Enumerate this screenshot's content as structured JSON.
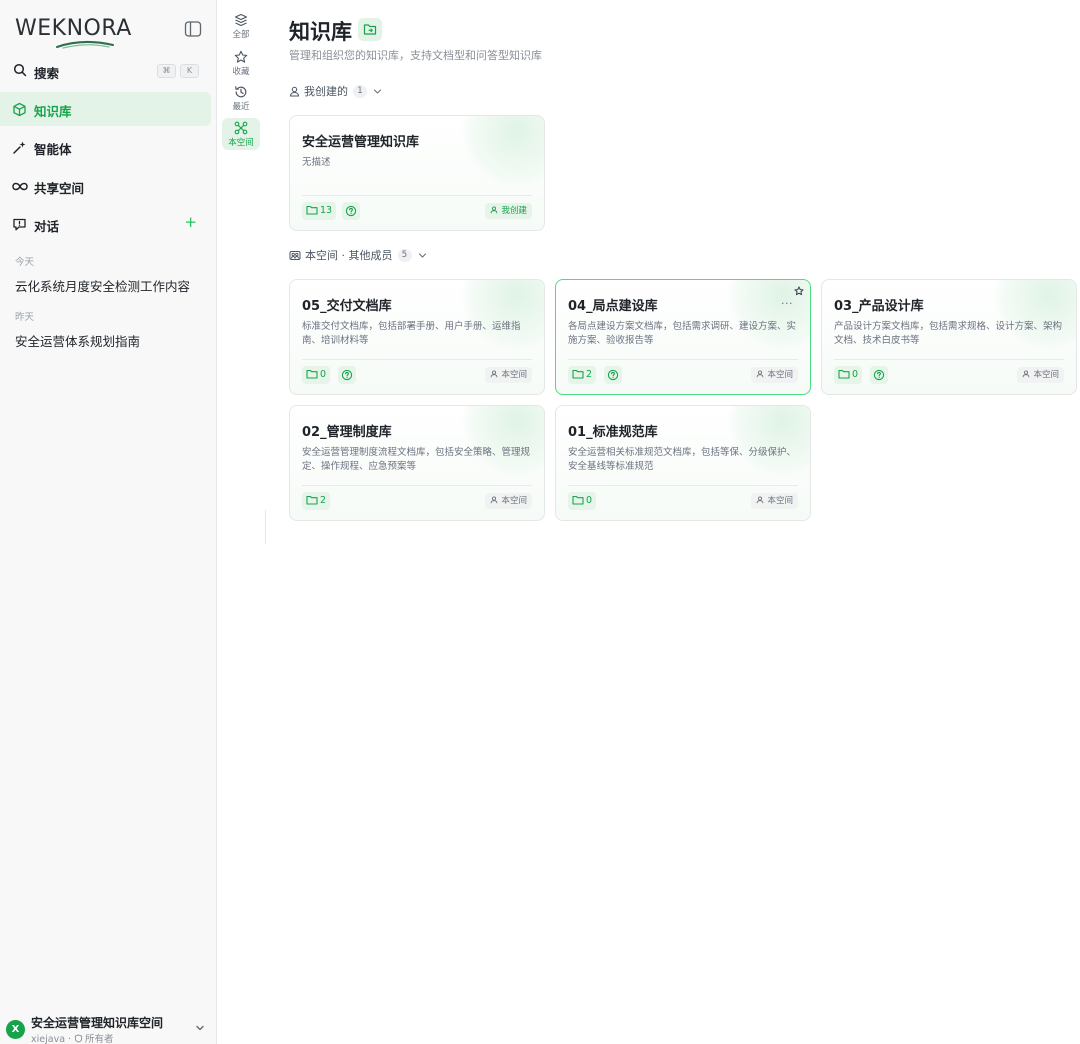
{
  "app": {
    "logo_text": "WEKNORA"
  },
  "sidebar": {
    "search": {
      "label": "搜索",
      "kbd": [
        "⌘",
        "K"
      ]
    },
    "nav": [
      {
        "key": "kb",
        "label": "知识库",
        "active": true
      },
      {
        "key": "agent",
        "label": "智能体",
        "active": false
      },
      {
        "key": "shared",
        "label": "共享空间",
        "active": false
      },
      {
        "key": "chat",
        "label": "对话",
        "active": false
      }
    ],
    "chat_groups": [
      {
        "label": "今天",
        "items": [
          "云化系统月度安全检测工作内容"
        ]
      },
      {
        "label": "昨天",
        "items": [
          "安全运营体系规划指南"
        ]
      }
    ],
    "space": {
      "avatar_letter": "X",
      "name": "安全运营管理知识库空间",
      "user": "xiejava",
      "role": "所有者"
    }
  },
  "filter_rail": [
    {
      "key": "all",
      "label": "全部",
      "active": false
    },
    {
      "key": "fav",
      "label": "收藏",
      "active": false
    },
    {
      "key": "recent",
      "label": "最近",
      "active": false
    },
    {
      "key": "space",
      "label": "本空间",
      "active": true
    }
  ],
  "main": {
    "title": "知识库",
    "description": "管理和组织您的知识库，支持文档型和问答型知识库",
    "sections": [
      {
        "label": "我创建的",
        "count": "1",
        "cards": [
          {
            "name": "安全运营管理知识库",
            "desc": "无描述",
            "doc_count": "13",
            "has_qa": true,
            "owner": "我创建",
            "owner_mine": true,
            "highlight": false
          }
        ]
      },
      {
        "label": "本空间 · 其他成员",
        "count": "5",
        "cards": [
          {
            "name": "05_交付文档库",
            "desc": "标准交付文档库，包括部署手册、用户手册、运维指南、培训材料等",
            "doc_count": "0",
            "has_qa": true,
            "owner": "本空间",
            "owner_mine": false,
            "highlight": false
          },
          {
            "name": "04_局点建设库",
            "desc": "各局点建设方案文档库，包括需求调研、建设方案、实施方案、验收报告等",
            "doc_count": "2",
            "has_qa": true,
            "owner": "本空间",
            "owner_mine": false,
            "highlight": true,
            "more": "···"
          },
          {
            "name": "03_产品设计库",
            "desc": "产品设计方案文档库，包括需求规格、设计方案、架构文档、技术白皮书等",
            "doc_count": "0",
            "has_qa": true,
            "owner": "本空间",
            "owner_mine": false,
            "highlight": false
          },
          {
            "name": "02_管理制度库",
            "desc": "安全运营管理制度流程文档库，包括安全策略、管理规定、操作规程、应急预案等",
            "doc_count": "2",
            "has_qa": false,
            "owner": "本空间",
            "owner_mine": false,
            "highlight": false
          },
          {
            "name": "01_标准规范库",
            "desc": "安全运营相关标准规范文档库，包括等保、分级保护、安全基线等标准规范",
            "doc_count": "0",
            "has_qa": false,
            "owner": "本空间",
            "owner_mine": false,
            "highlight": false
          }
        ]
      }
    ]
  },
  "colors": {
    "accent": "#16a34a",
    "accent_bg": "#e3f3e7",
    "highlight_border": "#4ade80"
  }
}
